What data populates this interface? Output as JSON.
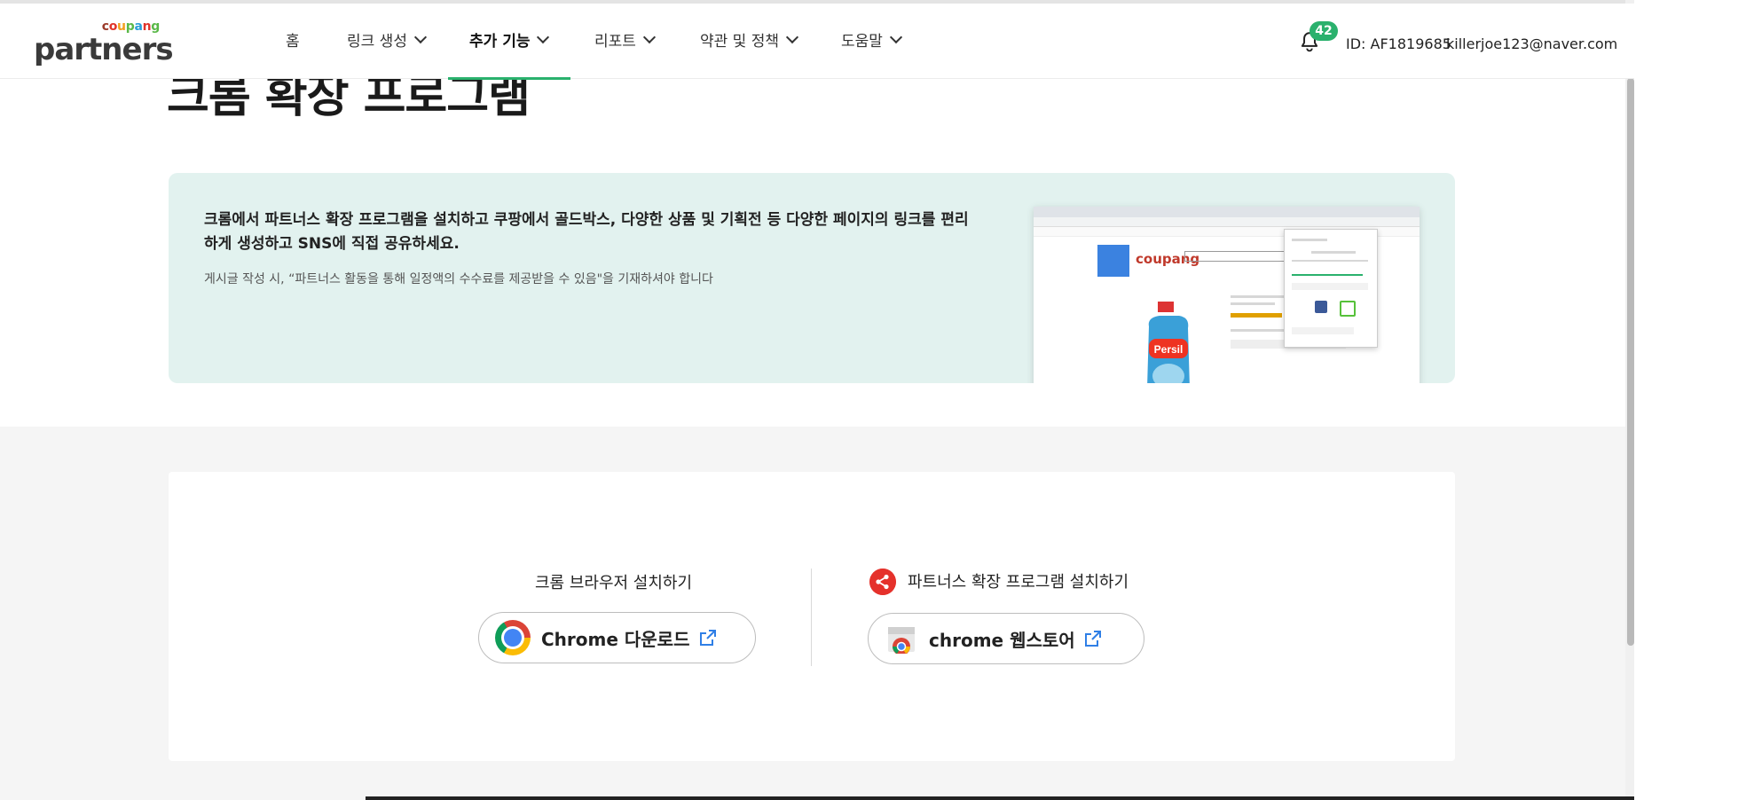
{
  "header": {
    "logo_small": "coupang",
    "logo_main": "partners",
    "nav": [
      {
        "label": "홈",
        "has_menu": false
      },
      {
        "label": "링크 생성",
        "has_menu": true
      },
      {
        "label": "추가 기능",
        "has_menu": true,
        "active": true
      },
      {
        "label": "리포트",
        "has_menu": true
      },
      {
        "label": "약관 및 정책",
        "has_menu": true
      },
      {
        "label": "도움말",
        "has_menu": true
      }
    ],
    "notification_count": "42",
    "account_id": "ID: AF1819685",
    "email": "killerjoe123@naver.com"
  },
  "page": {
    "title": "크롬 확장 프로그램"
  },
  "hero": {
    "headline": "크롬에서 파트너스 확장 프로그램을 설치하고 쿠팡에서 골드박스, 다양한 상품 및 기획전 등 다양한 페이지의 링크를 편리하게 생성하고 SNS에 직접 공유하세요.",
    "note": "게시글 작성 시, “파트너스 활동을 통해 일정액의 수수료를 제공받을 수 있음\"을 기재하셔야 합니다",
    "screenshot_brand": "coupang",
    "screenshot_product": "Persil"
  },
  "install": {
    "chrome": {
      "title": "크롬 브라우저 설치하기",
      "button_label": "Chrome 다운로드",
      "icon": "chrome-logo-icon"
    },
    "extension": {
      "title": "파트너스 확장 프로그램 설치하기",
      "button_label": "chrome 웹스토어",
      "icon": "chrome-webstore-icon"
    }
  },
  "colors": {
    "accent": "#2ab16d",
    "hero_bg": "#e2f2ef",
    "share_red": "#e5312b",
    "link_blue": "#2f7fe6"
  }
}
